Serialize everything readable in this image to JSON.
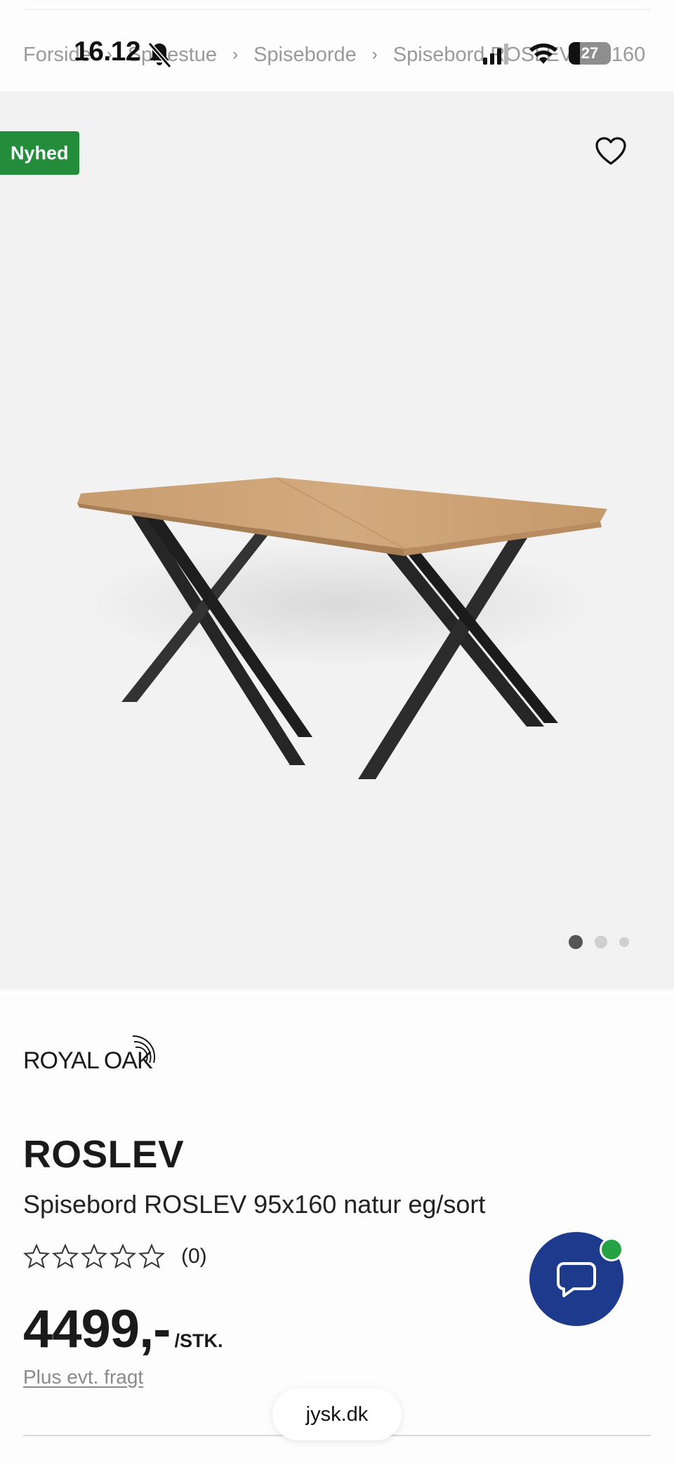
{
  "status_bar": {
    "time": "16.12",
    "battery_level": "27"
  },
  "breadcrumb": {
    "items": [
      "Forside",
      "Spisestue",
      "Spiseborde",
      "Spisebord ROSLEV 95x160"
    ]
  },
  "gallery": {
    "badge": "Nyhed",
    "image_count": 3,
    "active_index": 0
  },
  "product": {
    "brand": "ROYAL OAK",
    "name": "ROSLEV",
    "description": "Spisebord ROSLEV 95x160 natur eg/sort",
    "rating_count": "(0)",
    "rating_value": 0,
    "rating_max": 5,
    "price": "4499,-",
    "unit": "/STK.",
    "shipping_note": "Plus evt. fragt"
  },
  "browser": {
    "url": "jysk.dk"
  },
  "colors": {
    "badge_green": "#248d3c",
    "chat_blue": "#1d3a8c",
    "online_green": "#25a244",
    "gallery_bg": "#f2f2f2"
  },
  "icons": [
    "bell-muted-icon",
    "signal-icon",
    "wifi-icon",
    "heart-icon",
    "star-icon",
    "chat-icon"
  ]
}
